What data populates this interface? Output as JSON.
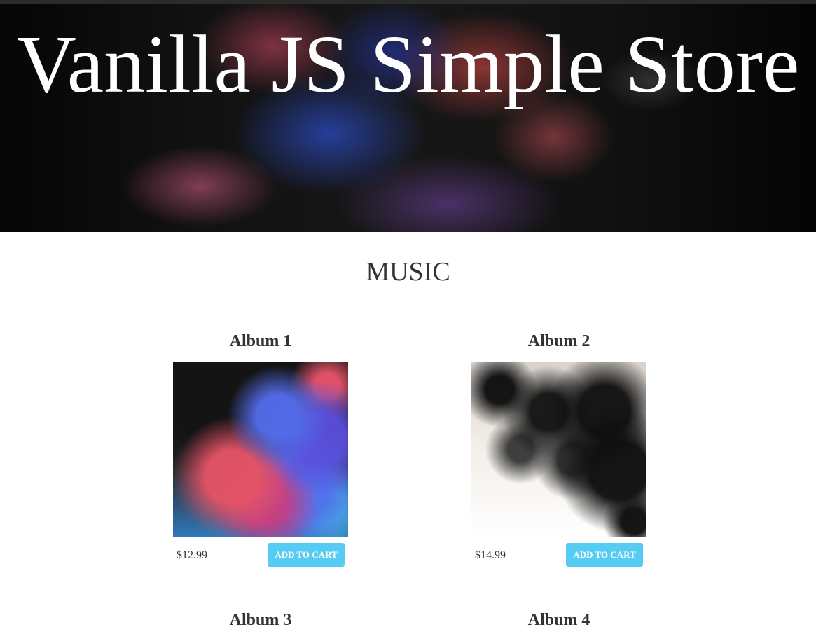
{
  "header": {
    "title": "Vanilla JS Simple Store"
  },
  "main": {
    "section_title": "MUSIC",
    "items": [
      {
        "title": "Album 1",
        "price": "$12.99",
        "button_label": "ADD TO CART",
        "image": "smoke-album-art"
      },
      {
        "title": "Album 2",
        "price": "$14.99",
        "button_label": "ADD TO CART",
        "image": "ink-album-art"
      },
      {
        "title": "Album 3"
      },
      {
        "title": "Album 4"
      }
    ]
  },
  "colors": {
    "button": "#56ccf2",
    "text": "#333333",
    "header_text": "#ffffff"
  }
}
